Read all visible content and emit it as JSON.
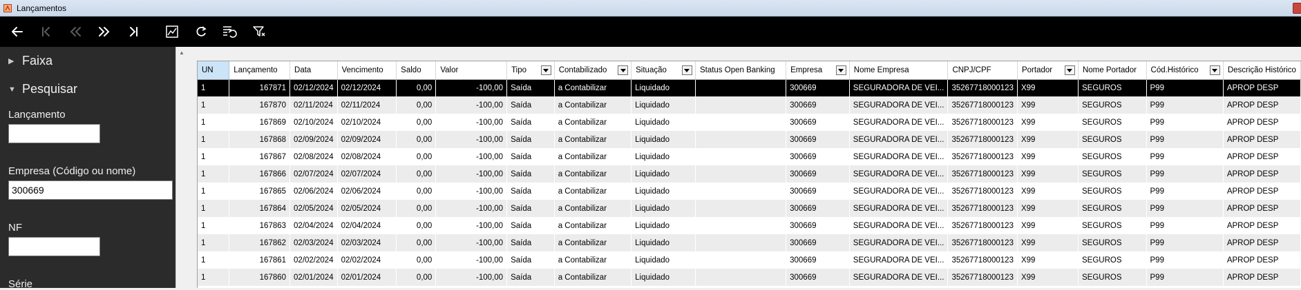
{
  "window": {
    "title": "Lançamentos"
  },
  "toolbar": {
    "buttons": [
      {
        "name": "back-button",
        "icon": "arrow-left-icon"
      },
      {
        "name": "first-button",
        "icon": "skip-first-icon"
      },
      {
        "name": "previous-button",
        "icon": "double-chevron-left-icon"
      },
      {
        "name": "next-button",
        "icon": "double-chevron-right-icon"
      },
      {
        "name": "last-button",
        "icon": "skip-last-icon"
      },
      {
        "name": "chart-button",
        "icon": "chart-icon"
      },
      {
        "name": "refresh-button",
        "icon": "refresh-icon"
      },
      {
        "name": "undo-list-button",
        "icon": "undo-list-icon"
      },
      {
        "name": "clear-filter-button",
        "icon": "clear-filter-icon"
      }
    ]
  },
  "sidebar": {
    "faixa": "Faixa",
    "pesquisar": "Pesquisar",
    "lancamento_label": "Lançamento",
    "lancamento_value": "",
    "empresa_label": "Empresa (Código ou nome)",
    "empresa_value": "300669",
    "nf_label": "NF",
    "nf_value": "",
    "serie_label": "Série"
  },
  "grid": {
    "columns": [
      {
        "label": "UN",
        "filter": false
      },
      {
        "label": "Lançamento",
        "filter": false
      },
      {
        "label": "Data",
        "filter": false
      },
      {
        "label": "Vencimento",
        "filter": false
      },
      {
        "label": "Saldo",
        "filter": false
      },
      {
        "label": "Valor",
        "filter": false
      },
      {
        "label": "Tipo",
        "filter": true
      },
      {
        "label": "Contabilizado",
        "filter": true
      },
      {
        "label": "Situação",
        "filter": true
      },
      {
        "label": "Status Open Banking",
        "filter": false
      },
      {
        "label": "Empresa",
        "filter": true
      },
      {
        "label": "Nome Empresa",
        "filter": false
      },
      {
        "label": "CNPJ/CPF",
        "filter": false
      },
      {
        "label": "Portador",
        "filter": true
      },
      {
        "label": "Nome Portador",
        "filter": false
      },
      {
        "label": "Cód.Histórico",
        "filter": true
      },
      {
        "label": "Descrição Histórico",
        "filter": false
      }
    ],
    "rows": [
      [
        "1",
        "167871",
        "02/12/2024",
        "02/12/2024",
        "0,00",
        "-100,00",
        "Saída",
        "a Contabilizar",
        "Liquidado",
        "",
        "300669",
        "SEGURADORA DE VEI...",
        "35267718000123",
        "X99",
        "SEGUROS",
        "P99",
        "APROP DESP"
      ],
      [
        "1",
        "167870",
        "02/11/2024",
        "02/11/2024",
        "0,00",
        "-100,00",
        "Saída",
        "a Contabilizar",
        "Liquidado",
        "",
        "300669",
        "SEGURADORA DE VEI...",
        "35267718000123",
        "X99",
        "SEGUROS",
        "P99",
        "APROP DESP"
      ],
      [
        "1",
        "167869",
        "02/10/2024",
        "02/10/2024",
        "0,00",
        "-100,00",
        "Saída",
        "a Contabilizar",
        "Liquidado",
        "",
        "300669",
        "SEGURADORA DE VEI...",
        "35267718000123",
        "X99",
        "SEGUROS",
        "P99",
        "APROP DESP"
      ],
      [
        "1",
        "167868",
        "02/09/2024",
        "02/09/2024",
        "0,00",
        "-100,00",
        "Saída",
        "a Contabilizar",
        "Liquidado",
        "",
        "300669",
        "SEGURADORA DE VEI...",
        "35267718000123",
        "X99",
        "SEGUROS",
        "P99",
        "APROP DESP"
      ],
      [
        "1",
        "167867",
        "02/08/2024",
        "02/08/2024",
        "0,00",
        "-100,00",
        "Saída",
        "a Contabilizar",
        "Liquidado",
        "",
        "300669",
        "SEGURADORA DE VEI...",
        "35267718000123",
        "X99",
        "SEGUROS",
        "P99",
        "APROP DESP"
      ],
      [
        "1",
        "167866",
        "02/07/2024",
        "02/07/2024",
        "0,00",
        "-100,00",
        "Saída",
        "a Contabilizar",
        "Liquidado",
        "",
        "300669",
        "SEGURADORA DE VEI...",
        "35267718000123",
        "X99",
        "SEGUROS",
        "P99",
        "APROP DESP"
      ],
      [
        "1",
        "167865",
        "02/06/2024",
        "02/06/2024",
        "0,00",
        "-100,00",
        "Saída",
        "a Contabilizar",
        "Liquidado",
        "",
        "300669",
        "SEGURADORA DE VEI...",
        "35267718000123",
        "X99",
        "SEGUROS",
        "P99",
        "APROP DESP"
      ],
      [
        "1",
        "167864",
        "02/05/2024",
        "02/05/2024",
        "0,00",
        "-100,00",
        "Saída",
        "a Contabilizar",
        "Liquidado",
        "",
        "300669",
        "SEGURADORA DE VEI...",
        "35267718000123",
        "X99",
        "SEGUROS",
        "P99",
        "APROP DESP"
      ],
      [
        "1",
        "167863",
        "02/04/2024",
        "02/04/2024",
        "0,00",
        "-100,00",
        "Saída",
        "a Contabilizar",
        "Liquidado",
        "",
        "300669",
        "SEGURADORA DE VEI...",
        "35267718000123",
        "X99",
        "SEGUROS",
        "P99",
        "APROP DESP"
      ],
      [
        "1",
        "167862",
        "02/03/2024",
        "02/03/2024",
        "0,00",
        "-100,00",
        "Saída",
        "a Contabilizar",
        "Liquidado",
        "",
        "300669",
        "SEGURADORA DE VEI...",
        "35267718000123",
        "X99",
        "SEGUROS",
        "P99",
        "APROP DESP"
      ],
      [
        "1",
        "167861",
        "02/02/2024",
        "02/02/2024",
        "0,00",
        "-100,00",
        "Saída",
        "a Contabilizar",
        "Liquidado",
        "",
        "300669",
        "SEGURADORA DE VEI...",
        "35267718000123",
        "X99",
        "SEGUROS",
        "P99",
        "APROP DESP"
      ],
      [
        "1",
        "167860",
        "02/01/2024",
        "02/01/2024",
        "0,00",
        "-100,00",
        "Saída",
        "a Contabilizar",
        "Liquidado",
        "",
        "300669",
        "SEGURADORA DE VEI...",
        "35267718000123",
        "X99",
        "SEGUROS",
        "P99",
        "APROP DESP"
      ]
    ]
  },
  "colors": {
    "selected_row": "#000000",
    "alt_row": "#ececec",
    "sidebar_bg": "#2b2b2b",
    "toolbar_bg": "#000000",
    "selected_header": "#cce4f7"
  }
}
